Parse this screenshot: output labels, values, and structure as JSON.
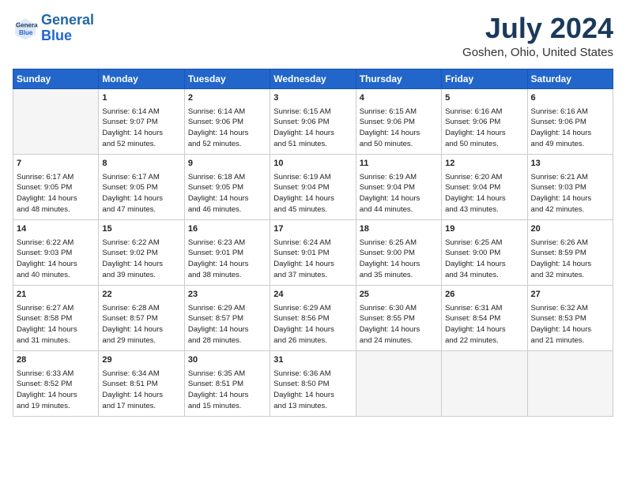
{
  "header": {
    "logo_line1": "General",
    "logo_line2": "Blue",
    "month_year": "July 2024",
    "location": "Goshen, Ohio, United States"
  },
  "days_of_week": [
    "Sunday",
    "Monday",
    "Tuesday",
    "Wednesday",
    "Thursday",
    "Friday",
    "Saturday"
  ],
  "weeks": [
    [
      {
        "day": "",
        "empty": true
      },
      {
        "day": "1",
        "sunrise": "6:14 AM",
        "sunset": "9:07 PM",
        "daylight": "14 hours and 52 minutes."
      },
      {
        "day": "2",
        "sunrise": "6:14 AM",
        "sunset": "9:06 PM",
        "daylight": "14 hours and 52 minutes."
      },
      {
        "day": "3",
        "sunrise": "6:15 AM",
        "sunset": "9:06 PM",
        "daylight": "14 hours and 51 minutes."
      },
      {
        "day": "4",
        "sunrise": "6:15 AM",
        "sunset": "9:06 PM",
        "daylight": "14 hours and 50 minutes."
      },
      {
        "day": "5",
        "sunrise": "6:16 AM",
        "sunset": "9:06 PM",
        "daylight": "14 hours and 50 minutes."
      },
      {
        "day": "6",
        "sunrise": "6:16 AM",
        "sunset": "9:06 PM",
        "daylight": "14 hours and 49 minutes."
      }
    ],
    [
      {
        "day": "7",
        "sunrise": "6:17 AM",
        "sunset": "9:05 PM",
        "daylight": "14 hours and 48 minutes."
      },
      {
        "day": "8",
        "sunrise": "6:17 AM",
        "sunset": "9:05 PM",
        "daylight": "14 hours and 47 minutes."
      },
      {
        "day": "9",
        "sunrise": "6:18 AM",
        "sunset": "9:05 PM",
        "daylight": "14 hours and 46 minutes."
      },
      {
        "day": "10",
        "sunrise": "6:19 AM",
        "sunset": "9:04 PM",
        "daylight": "14 hours and 45 minutes."
      },
      {
        "day": "11",
        "sunrise": "6:19 AM",
        "sunset": "9:04 PM",
        "daylight": "14 hours and 44 minutes."
      },
      {
        "day": "12",
        "sunrise": "6:20 AM",
        "sunset": "9:04 PM",
        "daylight": "14 hours and 43 minutes."
      },
      {
        "day": "13",
        "sunrise": "6:21 AM",
        "sunset": "9:03 PM",
        "daylight": "14 hours and 42 minutes."
      }
    ],
    [
      {
        "day": "14",
        "sunrise": "6:22 AM",
        "sunset": "9:03 PM",
        "daylight": "14 hours and 40 minutes."
      },
      {
        "day": "15",
        "sunrise": "6:22 AM",
        "sunset": "9:02 PM",
        "daylight": "14 hours and 39 minutes."
      },
      {
        "day": "16",
        "sunrise": "6:23 AM",
        "sunset": "9:01 PM",
        "daylight": "14 hours and 38 minutes."
      },
      {
        "day": "17",
        "sunrise": "6:24 AM",
        "sunset": "9:01 PM",
        "daylight": "14 hours and 37 minutes."
      },
      {
        "day": "18",
        "sunrise": "6:25 AM",
        "sunset": "9:00 PM",
        "daylight": "14 hours and 35 minutes."
      },
      {
        "day": "19",
        "sunrise": "6:25 AM",
        "sunset": "9:00 PM",
        "daylight": "14 hours and 34 minutes."
      },
      {
        "day": "20",
        "sunrise": "6:26 AM",
        "sunset": "8:59 PM",
        "daylight": "14 hours and 32 minutes."
      }
    ],
    [
      {
        "day": "21",
        "sunrise": "6:27 AM",
        "sunset": "8:58 PM",
        "daylight": "14 hours and 31 minutes."
      },
      {
        "day": "22",
        "sunrise": "6:28 AM",
        "sunset": "8:57 PM",
        "daylight": "14 hours and 29 minutes."
      },
      {
        "day": "23",
        "sunrise": "6:29 AM",
        "sunset": "8:57 PM",
        "daylight": "14 hours and 28 minutes."
      },
      {
        "day": "24",
        "sunrise": "6:29 AM",
        "sunset": "8:56 PM",
        "daylight": "14 hours and 26 minutes."
      },
      {
        "day": "25",
        "sunrise": "6:30 AM",
        "sunset": "8:55 PM",
        "daylight": "14 hours and 24 minutes."
      },
      {
        "day": "26",
        "sunrise": "6:31 AM",
        "sunset": "8:54 PM",
        "daylight": "14 hours and 22 minutes."
      },
      {
        "day": "27",
        "sunrise": "6:32 AM",
        "sunset": "8:53 PM",
        "daylight": "14 hours and 21 minutes."
      }
    ],
    [
      {
        "day": "28",
        "sunrise": "6:33 AM",
        "sunset": "8:52 PM",
        "daylight": "14 hours and 19 minutes."
      },
      {
        "day": "29",
        "sunrise": "6:34 AM",
        "sunset": "8:51 PM",
        "daylight": "14 hours and 17 minutes."
      },
      {
        "day": "30",
        "sunrise": "6:35 AM",
        "sunset": "8:51 PM",
        "daylight": "14 hours and 15 minutes."
      },
      {
        "day": "31",
        "sunrise": "6:36 AM",
        "sunset": "8:50 PM",
        "daylight": "14 hours and 13 minutes."
      },
      {
        "day": "",
        "empty": true
      },
      {
        "day": "",
        "empty": true
      },
      {
        "day": "",
        "empty": true
      }
    ]
  ]
}
